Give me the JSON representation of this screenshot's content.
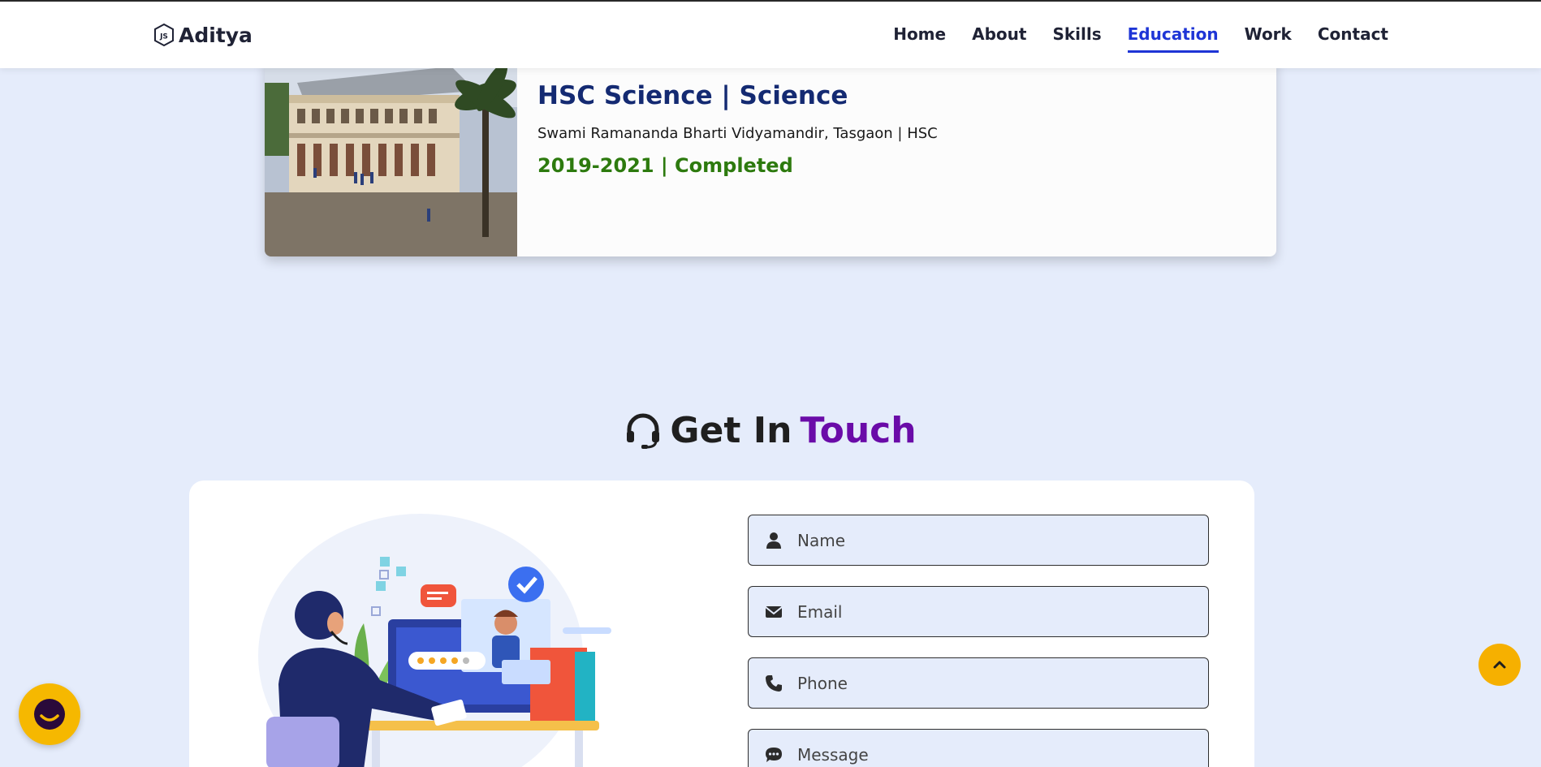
{
  "navbar": {
    "logo_text": "Aditya",
    "links": [
      {
        "label": "Home",
        "active": false
      },
      {
        "label": "About",
        "active": false
      },
      {
        "label": "Skills",
        "active": false
      },
      {
        "label": "Education",
        "active": true
      },
      {
        "label": "Work",
        "active": false
      },
      {
        "label": "Contact",
        "active": false
      }
    ]
  },
  "education": {
    "title": "HSC Science | Science",
    "school": "Swami Ramananda Bharti Vidyamandir, Tasgaon | HSC",
    "date_status": "2019-2021 | Completed"
  },
  "contact": {
    "heading_main": "Get In",
    "heading_accent": "Touch",
    "fields": {
      "name_placeholder": "Name",
      "email_placeholder": "Email",
      "phone_placeholder": "Phone",
      "message_placeholder": "Message"
    }
  },
  "colors": {
    "background": "#e5ecfb",
    "accent_nav": "#1e35d6",
    "title": "#142a72",
    "completed": "#2d7a0e",
    "heading_accent": "#6a0ba8",
    "float_button": "#f6b800"
  },
  "icons": {
    "logo": "nodejs-hex-icon",
    "heading": "headset-icon",
    "name": "user-icon",
    "email": "envelope-icon",
    "phone": "phone-icon",
    "message": "comment-dots-icon",
    "chat": "chat-bubble-icon",
    "scroll": "chevron-up-icon"
  }
}
